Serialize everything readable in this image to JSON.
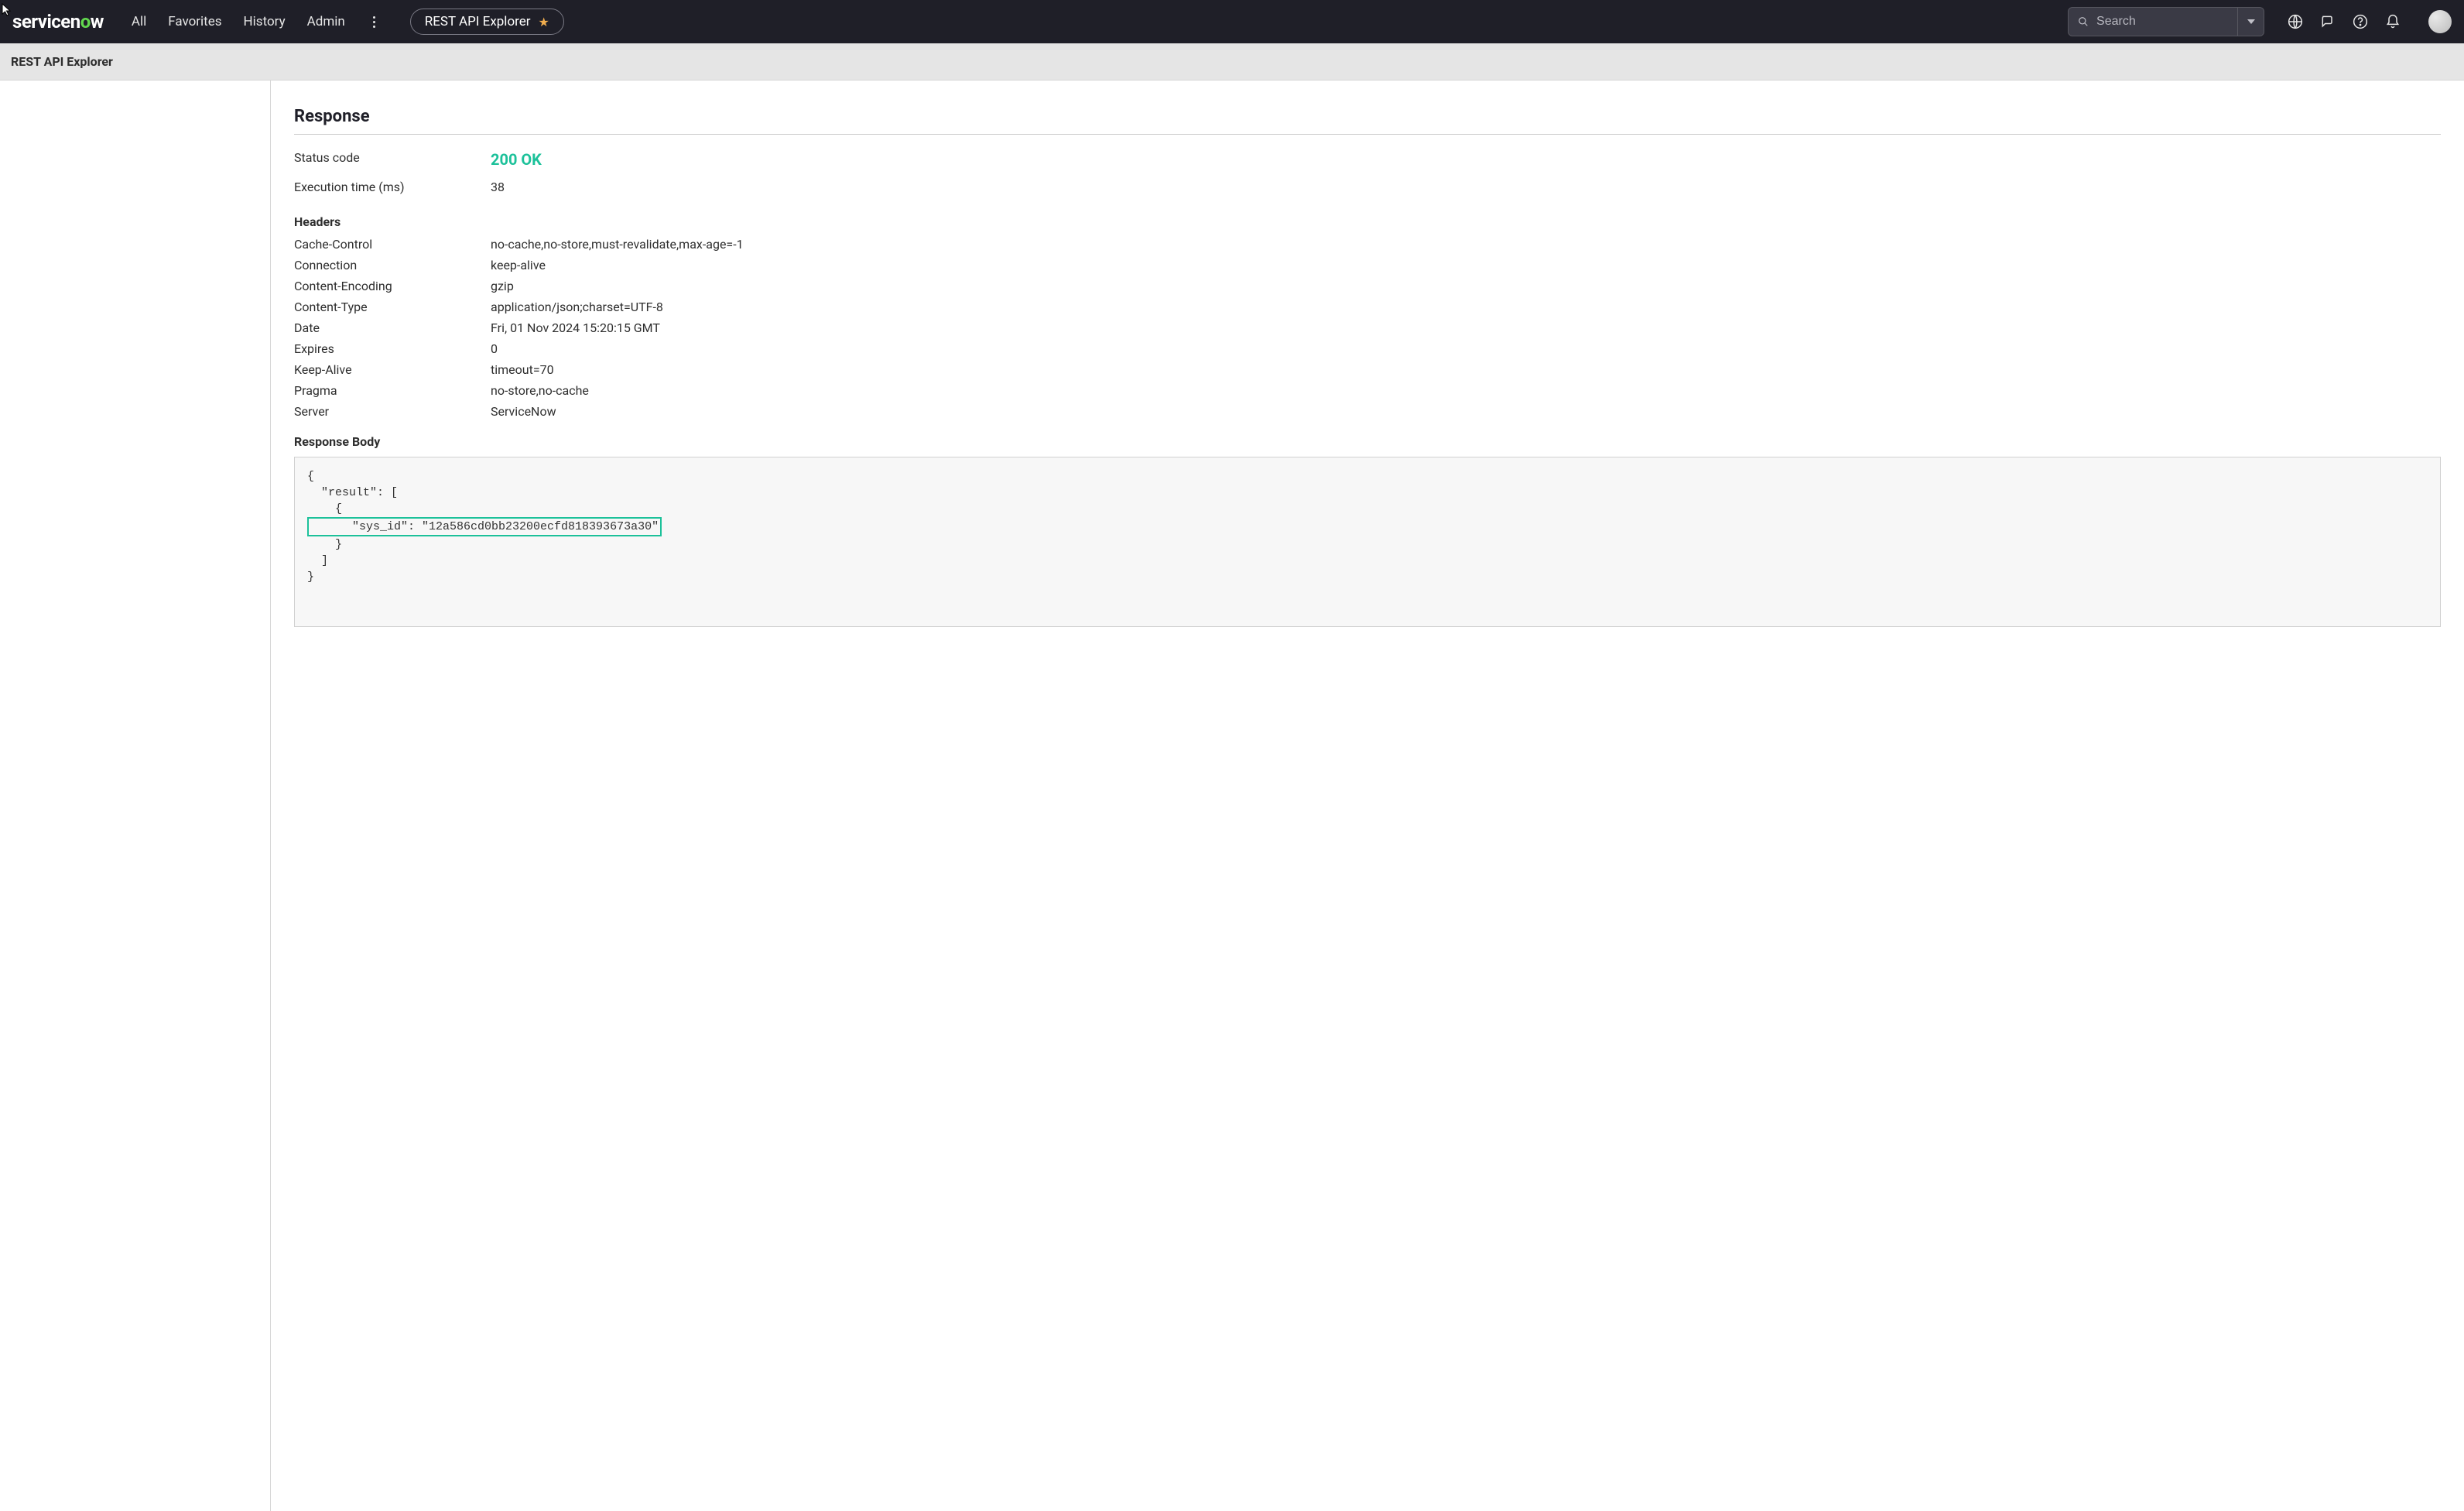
{
  "topbar": {
    "logo_pre": "servicen",
    "logo_o": "o",
    "logo_post": "w",
    "nav": [
      "All",
      "Favorites",
      "History",
      "Admin"
    ],
    "pill_label": "REST API Explorer",
    "search_placeholder": "Search"
  },
  "subheader": {
    "title": "REST API Explorer"
  },
  "response": {
    "title": "Response",
    "status_label": "Status code",
    "status_value": "200 OK",
    "exec_label": "Execution time (ms)",
    "exec_value": "38",
    "headers_title": "Headers",
    "headers": [
      {
        "k": "Cache-Control",
        "v": "no-cache,no-store,must-revalidate,max-age=-1"
      },
      {
        "k": "Connection",
        "v": "keep-alive"
      },
      {
        "k": "Content-Encoding",
        "v": "gzip"
      },
      {
        "k": "Content-Type",
        "v": "application/json;charset=UTF-8"
      },
      {
        "k": "Date",
        "v": "Fri, 01 Nov 2024 15:20:15 GMT"
      },
      {
        "k": "Expires",
        "v": "0"
      },
      {
        "k": "Keep-Alive",
        "v": "timeout=70"
      },
      {
        "k": "Pragma",
        "v": "no-store,no-cache"
      },
      {
        "k": "Server",
        "v": "ServiceNow"
      }
    ],
    "body_title": "Response Body",
    "body_lines": {
      "l1": "{",
      "l2": "  \"result\": [",
      "l3": "    {",
      "l4": "      \"sys_id\": \"12a586cd0bb23200ecfd818393673a30\"",
      "l5": "    }",
      "l6": "  ]",
      "l7": "}"
    }
  }
}
